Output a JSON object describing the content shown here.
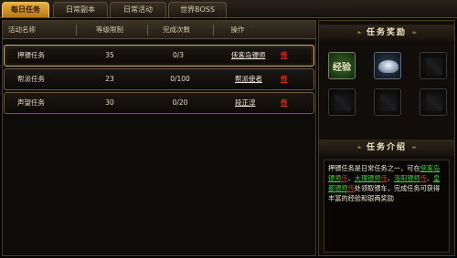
{
  "tabs": [
    {
      "label": "每日任务",
      "active": true
    },
    {
      "label": "日常副本",
      "active": false
    },
    {
      "label": "日常活动",
      "active": false
    },
    {
      "label": "世界BOSS",
      "active": false
    }
  ],
  "table": {
    "columns": [
      "活动名称",
      "等级限制",
      "完成次数",
      "操作"
    ],
    "rows": [
      {
        "name": "押镖任务",
        "level": "35",
        "count": "0/3",
        "npc": "侠客岛镖师",
        "go": "传"
      },
      {
        "name": "帮派任务",
        "level": "23",
        "count": "0/100",
        "npc": "帮派使者",
        "go": "传"
      },
      {
        "name": "声望任务",
        "level": "30",
        "count": "0/20",
        "npc": "段正淳",
        "go": "传"
      }
    ]
  },
  "reward_panel": {
    "title": "任务奖励",
    "exp_label": "经验",
    "ornament": "❧"
  },
  "intro_panel": {
    "title": "任务介绍",
    "text_1": "押镖任务是日常任务之一，可在",
    "npc_1": "侠客岛镖师",
    "go_1": "传",
    "sep_1": "、",
    "npc_2": "大理镖师",
    "go_2": "传",
    "sep_2": "、",
    "npc_3": "洛阳镖师",
    "go_3": "传",
    "sep_3": "、",
    "npc_4": "皇都镖师",
    "go_4": "传",
    "text_2": "处领取镖车，完成任务可获得丰富的经验和银两奖励"
  },
  "colors": {
    "active_tab": "#e9b040",
    "npc_link_green": "#3cd23c",
    "teleport_red": "#e02a1a"
  }
}
